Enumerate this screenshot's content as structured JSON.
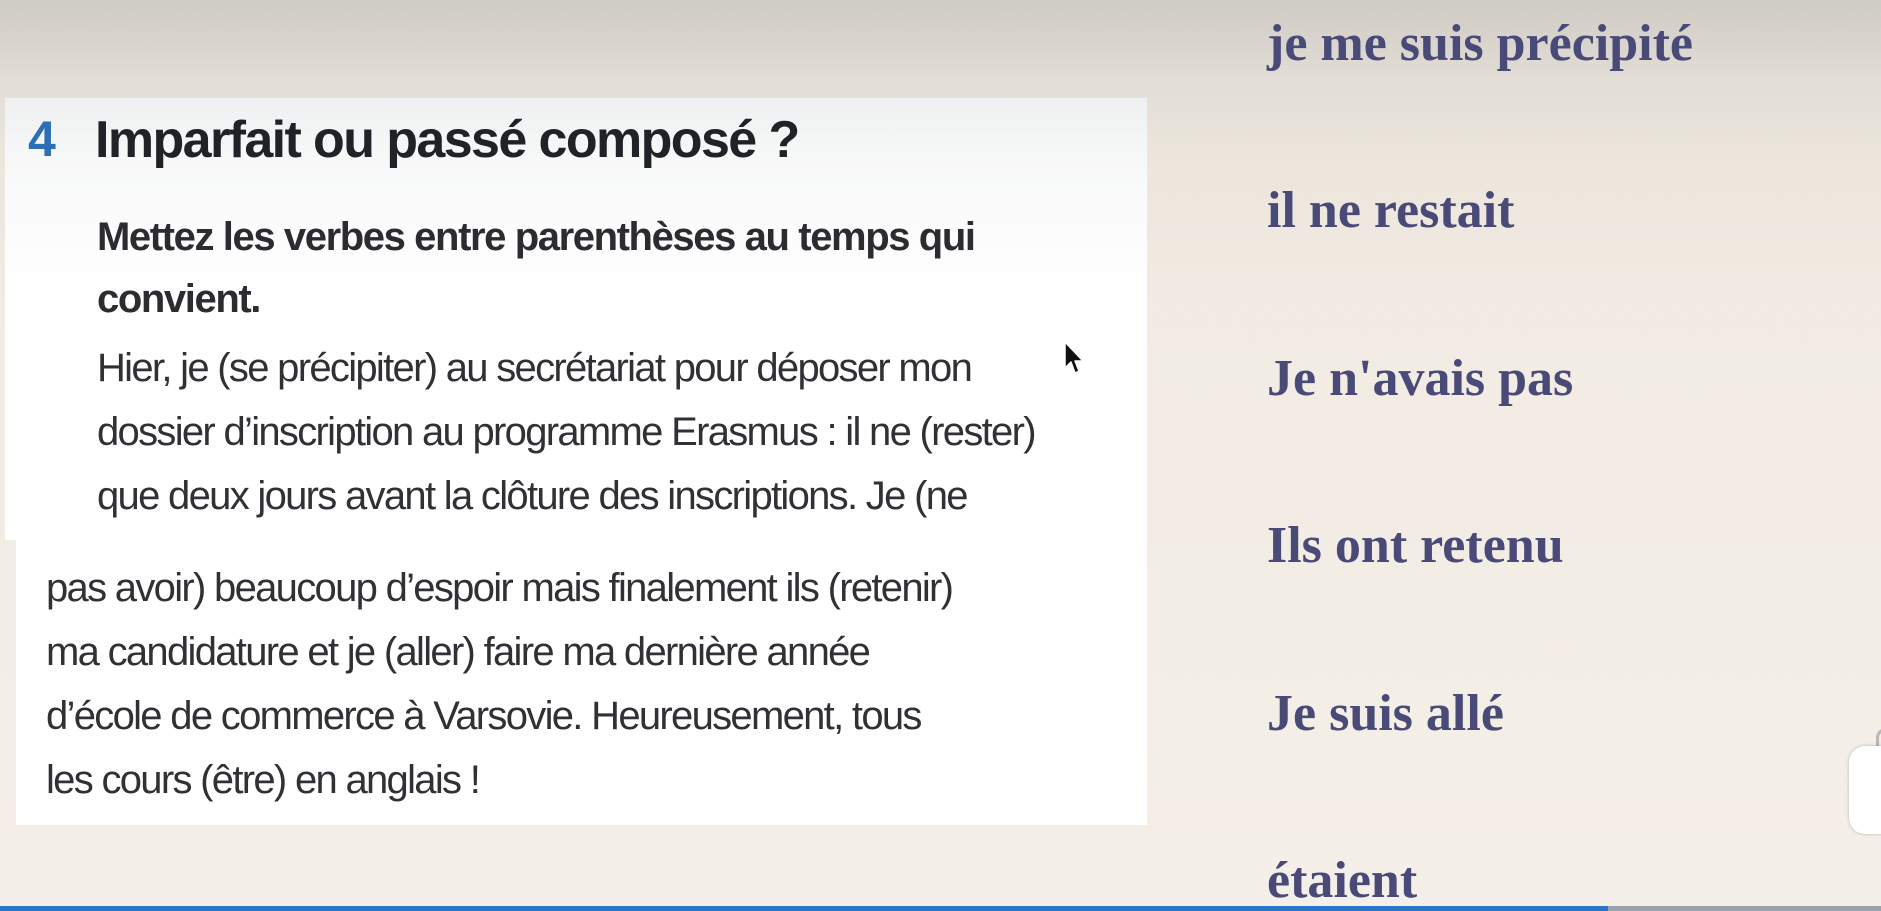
{
  "exercise": {
    "number": "4",
    "title": "Imparfait ou passé composé ?",
    "instruction_lines": [
      "Mettez les verbes entre parenthèses au temps qui",
      "convient."
    ],
    "paragraph_top": [
      "Hier, je (se précipiter) au secrétariat pour déposer mon",
      "dossier d’inscription au programme Erasmus : il ne (rester)",
      "que deux jours avant la clôture des inscriptions. Je (ne"
    ],
    "paragraph_bottom": [
      "pas avoir) beaucoup d’espoir mais finalement ils (retenir)",
      "ma candidature et je (aller) faire ma dernière année",
      "d’école de commerce à Varsovie. Heureusement, tous",
      "les cours (être) en anglais !"
    ]
  },
  "answers": [
    "je me suis précipité",
    "il ne restait",
    "Je n'avais pas",
    "Ils ont retenu",
    "Je suis allé",
    "étaient"
  ],
  "video_progress": {
    "fraction": 0.855
  },
  "colors": {
    "answer_text": "#4a4a78",
    "exercise_number": "#2c6fb4",
    "progress": "#2b73c7"
  },
  "icons": {
    "cursor": "mouse-pointer-icon"
  }
}
